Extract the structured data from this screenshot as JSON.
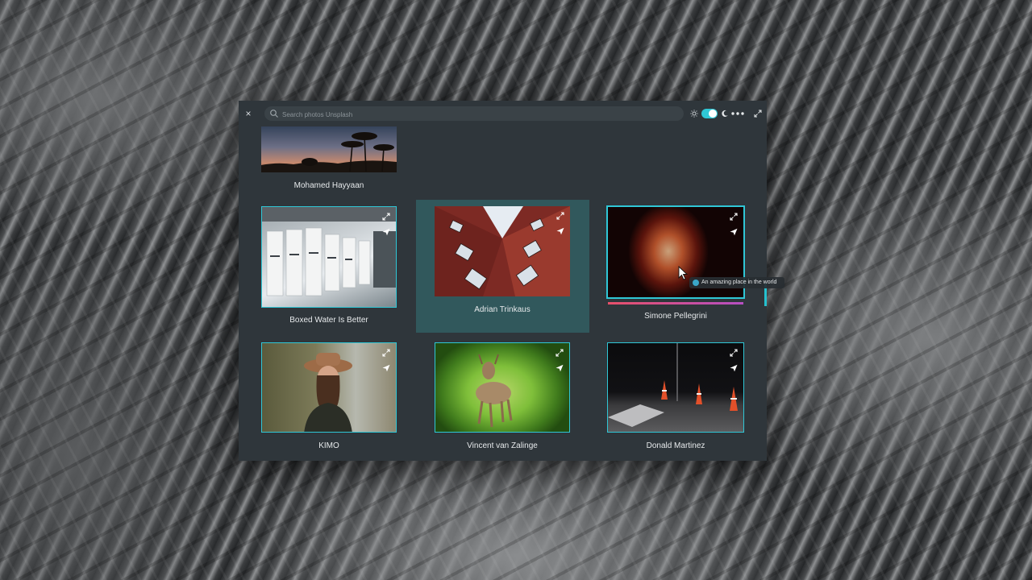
{
  "search": {
    "placeholder": "Search photos Unsplash"
  },
  "toolbar": {
    "close_label": "×"
  },
  "photos": [
    {
      "author": "Mohamed Hayyaan"
    },
    {
      "author": "Boxed Water Is Better"
    },
    {
      "author": "Adrian Trinkaus"
    },
    {
      "author": "Simone Pellegrini"
    },
    {
      "author": "KIMO"
    },
    {
      "author": "Vincent van Zalinge"
    },
    {
      "author": "Donald Martinez"
    }
  ],
  "tooltip": {
    "text": "An amazing place in the world"
  },
  "colors": {
    "accent": "#2fc7d6",
    "window_bg": "#2f363b",
    "selected_card": "#31585c",
    "progress_gradient": [
      "#e8506a",
      "#b64fc3"
    ]
  }
}
